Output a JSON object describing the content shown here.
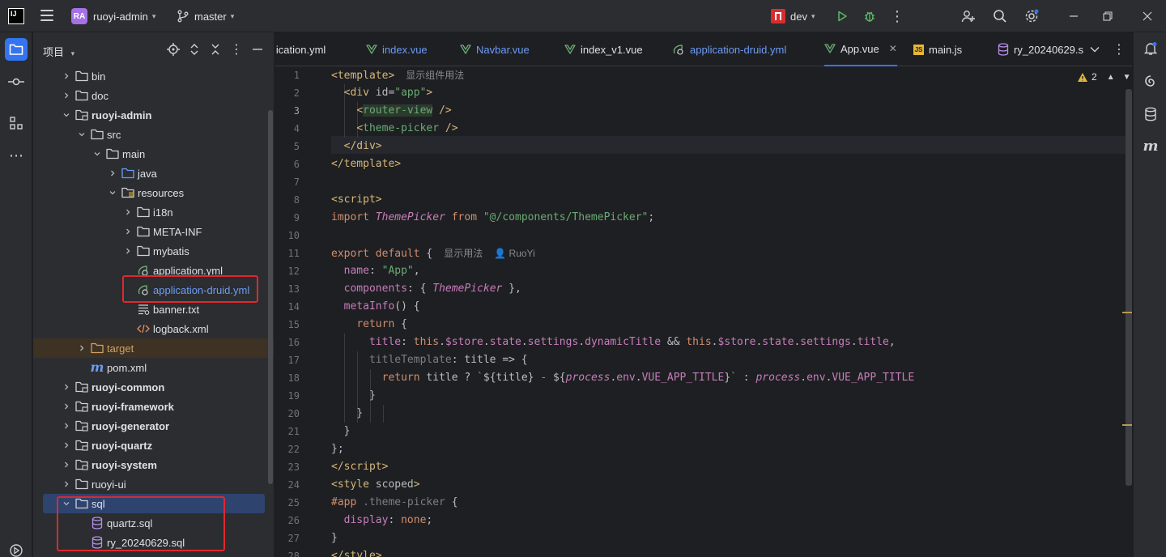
{
  "titlebar": {
    "project_badge": "RA",
    "project_name": "ruoyi-admin",
    "branch": "master",
    "run_config": "dev"
  },
  "project_panel": {
    "title": "项目",
    "tree": [
      {
        "label": "bin",
        "indent": 1,
        "type": "folder",
        "expanded": false
      },
      {
        "label": "doc",
        "indent": 1,
        "type": "folder",
        "expanded": false
      },
      {
        "label": "ruoyi-admin",
        "indent": 1,
        "type": "module",
        "expanded": true,
        "bold": true
      },
      {
        "label": "src",
        "indent": 2,
        "type": "folder",
        "expanded": true
      },
      {
        "label": "main",
        "indent": 3,
        "type": "folder",
        "expanded": true
      },
      {
        "label": "java",
        "indent": 4,
        "type": "source-folder",
        "expanded": false
      },
      {
        "label": "resources",
        "indent": 4,
        "type": "resource-folder",
        "expanded": true
      },
      {
        "label": "i18n",
        "indent": 5,
        "type": "folder",
        "expanded": false
      },
      {
        "label": "META-INF",
        "indent": 5,
        "type": "folder",
        "expanded": false
      },
      {
        "label": "mybatis",
        "indent": 5,
        "type": "folder",
        "expanded": false
      },
      {
        "label": "application.yml",
        "indent": 5,
        "type": "yml",
        "leaf": true
      },
      {
        "label": "application-druid.yml",
        "indent": 5,
        "type": "yml",
        "leaf": true,
        "color": "blue"
      },
      {
        "label": "banner.txt",
        "indent": 5,
        "type": "txt",
        "leaf": true
      },
      {
        "label": "logback.xml",
        "indent": 5,
        "type": "xml",
        "leaf": true
      },
      {
        "label": "target",
        "indent": 2,
        "type": "excluded-folder",
        "expanded": false,
        "color": "orange"
      },
      {
        "label": "pom.xml",
        "indent": 2,
        "type": "maven",
        "leaf": true
      },
      {
        "label": "ruoyi-common",
        "indent": 1,
        "type": "module",
        "expanded": false,
        "bold": true
      },
      {
        "label": "ruoyi-framework",
        "indent": 1,
        "type": "module",
        "expanded": false,
        "bold": true
      },
      {
        "label": "ruoyi-generator",
        "indent": 1,
        "type": "module",
        "expanded": false,
        "bold": true
      },
      {
        "label": "ruoyi-quartz",
        "indent": 1,
        "type": "module",
        "expanded": false,
        "bold": true
      },
      {
        "label": "ruoyi-system",
        "indent": 1,
        "type": "module",
        "expanded": false,
        "bold": true
      },
      {
        "label": "ruoyi-ui",
        "indent": 1,
        "type": "folder",
        "expanded": false
      },
      {
        "label": "sql",
        "indent": 1,
        "type": "folder",
        "expanded": true,
        "selected": true
      },
      {
        "label": "quartz.sql",
        "indent": 2,
        "type": "sql",
        "leaf": true
      },
      {
        "label": "ry_20240629.sql",
        "indent": 2,
        "type": "sql",
        "leaf": true
      }
    ]
  },
  "editor": {
    "tabs": [
      {
        "label": "lication.yml",
        "icon": "yml"
      },
      {
        "label": "index.vue",
        "icon": "vue",
        "modified": true
      },
      {
        "label": "Navbar.vue",
        "icon": "vue",
        "modified": true
      },
      {
        "label": "index_v1.vue",
        "icon": "vue"
      },
      {
        "label": "application-druid.yml",
        "icon": "yml",
        "modified": true
      },
      {
        "label": "App.vue",
        "icon": "vue",
        "active": true
      },
      {
        "label": "main.js",
        "icon": "js"
      },
      {
        "label": "ry_20240629.s",
        "icon": "sql"
      }
    ],
    "warnings_count": "2",
    "hint_template": "显示组件用法",
    "hint_export": "显示用法",
    "hint_author": "RuoYi",
    "line_numbers": [
      "1",
      "2",
      "3",
      "4",
      "5",
      "6",
      "7",
      "8",
      "9",
      "10",
      "11",
      "12",
      "13",
      "14",
      "15",
      "16",
      "17",
      "18",
      "19",
      "20",
      "21",
      "22",
      "23",
      "24",
      "25",
      "26",
      "27",
      "28"
    ]
  },
  "colors": {
    "accent": "#3574f0",
    "annotation_box": "#e0282e"
  }
}
